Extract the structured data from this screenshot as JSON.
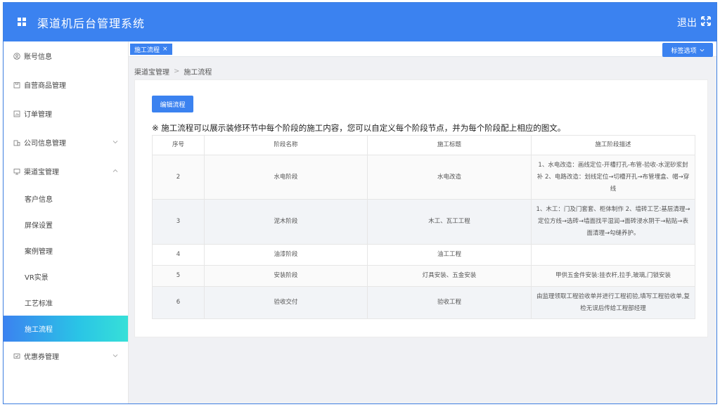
{
  "header": {
    "title": "渠道机后台管理系统",
    "logout_label": "退出"
  },
  "sidebar": {
    "items": [
      {
        "label": "账号信息",
        "icon": "user-circle-icon"
      },
      {
        "label": "自营商品管理",
        "icon": "box-icon"
      },
      {
        "label": "订单管理",
        "icon": "document-icon"
      },
      {
        "label": "公司信息管理",
        "icon": "building-icon"
      },
      {
        "label": "渠道宝管理",
        "icon": "monitor-icon"
      }
    ],
    "sub_items": [
      {
        "label": "客户信息"
      },
      {
        "label": "屏保设置"
      },
      {
        "label": "案例管理"
      },
      {
        "label": "VR实景"
      },
      {
        "label": "工艺标准"
      },
      {
        "label": "施工流程"
      }
    ],
    "last_item": {
      "label": "优惠券管理",
      "icon": "coupon-icon"
    }
  },
  "tabs": {
    "active_tab": "施工流程",
    "close_glyph": "×",
    "options_label": "标签选项"
  },
  "breadcrumb": {
    "root": "渠道宝管理",
    "separator": ">",
    "current": "施工流程"
  },
  "content": {
    "edit_button": "编辑流程",
    "notice": "※ 施工流程可以展示装修环节中每个阶段的施工内容，您可以自定义每个阶段节点，并为每个阶段配上相应的图文。",
    "columns": [
      "序号",
      "阶段名称",
      "施工标题",
      "施工阶段描述"
    ],
    "rows": [
      {
        "no": "2",
        "stage": "水电阶段",
        "title": "水电改造",
        "desc": "1、水电改造：画线定位-开槽打孔-布管-验收-水泥砂浆封补 2、电路改造：划线定位→切槽开孔→布管埋盒、帽→穿线"
      },
      {
        "no": "3",
        "stage": "泥木阶段",
        "title": "木工、瓦工工程",
        "desc": "1、木工：门及门套套、柜体制作 2、墙砖工艺:基层清理→定位方线→选砖→墙面找平湿润→面砖浸水阴干→粘贴→表面清理→勾缝养护。"
      },
      {
        "no": "4",
        "stage": "油漆阶段",
        "title": "油工工程",
        "desc": ""
      },
      {
        "no": "5",
        "stage": "安装阶段",
        "title": "灯具安装、五金安装",
        "desc": "甲供五金件安装:挂衣杆,拉手,玻璃,门锁安装"
      },
      {
        "no": "6",
        "stage": "验收交付",
        "title": "验收工程",
        "desc": "由监理领取工程验收单并进行工程初验,填写工程验收单,复检无误后传给工程部经理"
      }
    ]
  }
}
